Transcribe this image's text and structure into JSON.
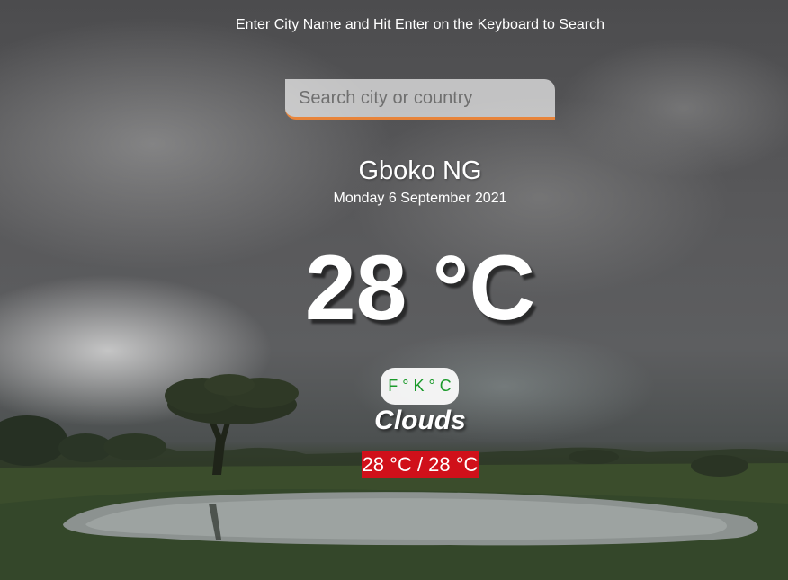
{
  "header": {
    "instruction": "Enter City Name and Hit Enter on the Keyboard to Search"
  },
  "search": {
    "placeholder": "Search city or country",
    "value": ""
  },
  "weather": {
    "location": "Gboko NG",
    "date": "Monday 6 September 2021",
    "temperature": "28 °C",
    "units": [
      {
        "label": "F °"
      },
      {
        "label": "K °"
      },
      {
        "label": "C"
      }
    ],
    "condition": "Clouds",
    "hilo": "28 °C / 28 °C"
  },
  "colors": {
    "accent": "#e8843a",
    "unit_text": "#1a9a2a",
    "hilo_bg": "#d0101a"
  }
}
